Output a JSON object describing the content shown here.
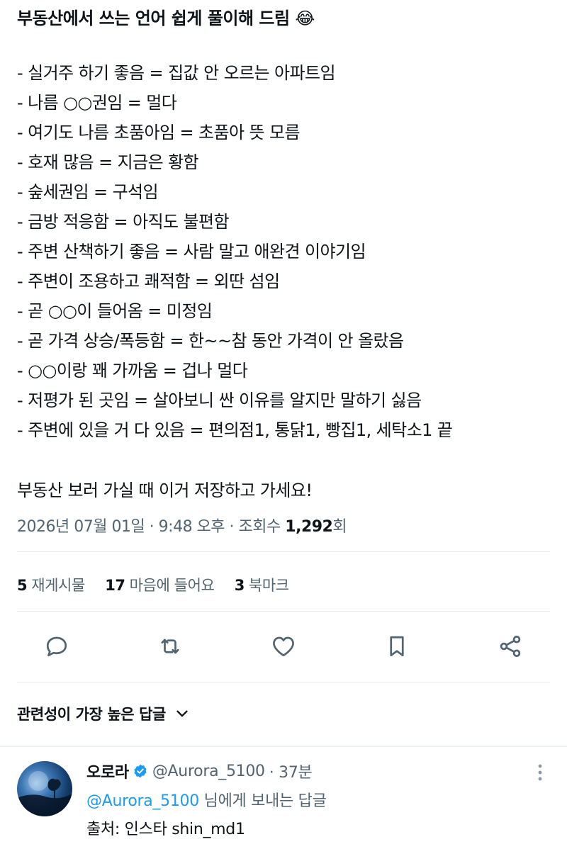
{
  "post": {
    "title": "부동산에서 쓰는 언어 쉽게 풀이해 드림",
    "title_emoji": "😂",
    "lines": [
      "- 실거주 하기 좋음 = 집값 안 오르는 아파트임",
      "- 나름 ○○권임 = 멀다",
      "- 여기도 나름 초품아임 = 초품아 뜻 모름",
      "- 호재 많음 = 지금은 황함",
      "- 숲세권임 = 구석임",
      "- 금방 적응함 = 아직도 불편함",
      "- 주변 산책하기 좋음 = 사람 말고 애완견 이야기임",
      "- 주변이 조용하고 쾌적함 = 외딴 섬임",
      "- 곧 ○○이 들어옴 = 미정임",
      "- 곧 가격 상승/폭등함 = 한~~참 동안 가격이 안 올랐음",
      "- ○○이랑 꽤 가까움 = 겁나 멀다",
      "- 저평가 된 곳임 = 살아보니 싼 이유를 알지만 말하기 싫음",
      "- 주변에 있을 거 다 있음 = 편의점1, 통닭1, 빵집1, 세탁소1 끝"
    ],
    "closing": "부동산 보러 가실 때 이거  저장하고 가세요!",
    "meta": {
      "date": "2026년 07월 01일",
      "sep": " · ",
      "time": "9:48 오후",
      "views_label": "조회수",
      "views_count": "1,292",
      "views_unit": "회"
    }
  },
  "stats": {
    "reposts_count": "5",
    "reposts_label": "재게시물",
    "likes_count": "17",
    "likes_label": "마음에 들어요",
    "bookmarks_count": "3",
    "bookmarks_label": "북마크"
  },
  "actions": {
    "reply": "reply-icon",
    "repost": "repost-icon",
    "like": "heart-icon",
    "bookmark": "bookmark-icon",
    "share": "share-icon"
  },
  "sort": {
    "label": "관련성이 가장 높은 답글"
  },
  "reply": {
    "name": "오로라",
    "handle": "@Aurora_5100",
    "time": "· 37분",
    "replying_mention": "@Aurora_5100",
    "replying_suffix": " 님에게 보내는 답글",
    "body": "출처: 인스타 shin_md1"
  },
  "colors": {
    "text": "#0f1419",
    "muted": "#536471",
    "accent": "#1d9bf0",
    "divider": "#e6e9eb"
  }
}
